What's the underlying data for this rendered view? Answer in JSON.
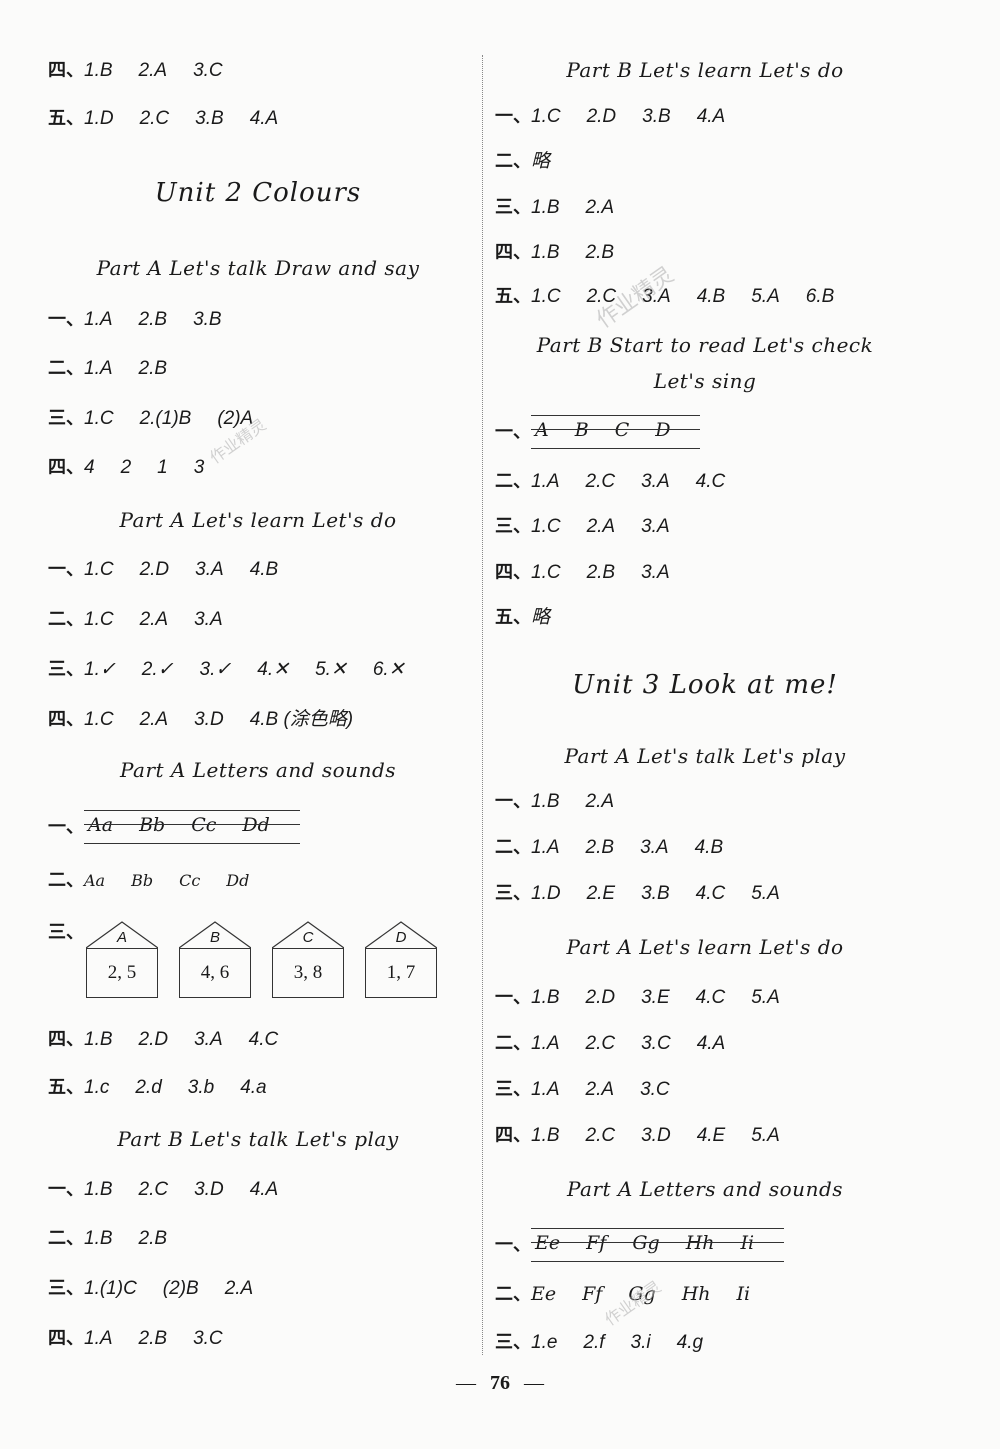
{
  "left": {
    "rows_top": [
      {
        "label": "四、",
        "items": [
          "1.B",
          "2.A",
          "3.C"
        ]
      },
      {
        "label": "五、",
        "items": [
          "1.D",
          "2.C",
          "3.B",
          "4.A"
        ]
      }
    ],
    "unit2_title": "Unit 2   Colours",
    "sections": [
      {
        "heading": "Part A   Let's talk   Draw and say",
        "rows": [
          {
            "label": "一、",
            "items": [
              "1.A",
              "2.B",
              "3.B"
            ]
          },
          {
            "label": "二、",
            "items": [
              "1.A",
              "2.B"
            ]
          },
          {
            "label": "三、",
            "items": [
              "1.C",
              "2.(1)B",
              "(2)A"
            ]
          },
          {
            "label": "四、",
            "items": [
              "4",
              "2",
              "1",
              "3"
            ]
          }
        ]
      },
      {
        "heading": "Part A   Let's learn   Let's do",
        "rows": [
          {
            "label": "一、",
            "items": [
              "1.C",
              "2.D",
              "3.A",
              "4.B"
            ]
          },
          {
            "label": "二、",
            "items": [
              "1.C",
              "2.A",
              "3.A"
            ]
          },
          {
            "label": "三、",
            "items": [
              "1.✓",
              "2.✓",
              "3.✓",
              "4.✕",
              "5.✕",
              "6.✕"
            ]
          },
          {
            "label": "四、",
            "items": [
              "1.C",
              "2.A",
              "3.D",
              "4.B (涂色略)"
            ]
          }
        ]
      },
      {
        "heading": "Part A   Letters and sounds",
        "lined": {
          "label": "一、",
          "letters": [
            "Aa",
            "Bb",
            "Cc",
            "Dd"
          ]
        },
        "row2": {
          "label": "二、",
          "items": [
            "Aa",
            "Bb",
            "Cc",
            "Dd"
          ]
        },
        "houses_label": "三、",
        "houses": [
          {
            "roof": "A",
            "value": "2, 5"
          },
          {
            "roof": "B",
            "value": "4, 6"
          },
          {
            "roof": "C",
            "value": "3, 8"
          },
          {
            "roof": "D",
            "value": "1, 7"
          }
        ],
        "rows": [
          {
            "label": "四、",
            "items": [
              "1.B",
              "2.D",
              "3.A",
              "4.C"
            ]
          },
          {
            "label": "五、",
            "items": [
              "1.c",
              "2.d",
              "3.b",
              "4.a"
            ]
          }
        ]
      },
      {
        "heading": "Part B   Let's talk   Let's play",
        "rows": [
          {
            "label": "一、",
            "items": [
              "1.B",
              "2.C",
              "3.D",
              "4.A"
            ]
          },
          {
            "label": "二、",
            "items": [
              "1.B",
              "2.B"
            ]
          },
          {
            "label": "三、",
            "items": [
              "1.(1)C",
              "(2)B",
              "2.A"
            ]
          },
          {
            "label": "四、",
            "items": [
              "1.A",
              "2.B",
              "3.C"
            ]
          }
        ]
      }
    ]
  },
  "right": {
    "sections": [
      {
        "heading": "Part B   Let's learn   Let's do",
        "rows": [
          {
            "label": "一、",
            "items": [
              "1.C",
              "2.D",
              "3.B",
              "4.A"
            ]
          },
          {
            "label": "二、",
            "items": [
              "略"
            ]
          },
          {
            "label": "三、",
            "items": [
              "1.B",
              "2.A"
            ]
          },
          {
            "label": "四、",
            "items": [
              "1.B",
              "2.B"
            ]
          },
          {
            "label": "五、",
            "items": [
              "1.C",
              "2.C",
              "3.A",
              "4.B",
              "5.A",
              "6.B"
            ]
          }
        ]
      },
      {
        "heading": "Part B   Start to read   Let's check",
        "heading2": "Let's sing",
        "lined": {
          "label": "一、",
          "letters": [
            "A",
            "B",
            "C",
            "D"
          ]
        },
        "rows": [
          {
            "label": "二、",
            "items": [
              "1.A",
              "2.C",
              "3.A",
              "4.C"
            ]
          },
          {
            "label": "三、",
            "items": [
              "1.C",
              "2.A",
              "3.A"
            ]
          },
          {
            "label": "四、",
            "items": [
              "1.C",
              "2.B",
              "3.A"
            ]
          },
          {
            "label": "五、",
            "items": [
              "略"
            ]
          }
        ]
      }
    ],
    "unit3_title": "Unit 3   Look at me!",
    "sections2": [
      {
        "heading": "Part A   Let's talk   Let's play",
        "rows": [
          {
            "label": "一、",
            "items": [
              "1.B",
              "2.A"
            ]
          },
          {
            "label": "二、",
            "items": [
              "1.A",
              "2.B",
              "3.A",
              "4.B"
            ]
          },
          {
            "label": "三、",
            "items": [
              "1.D",
              "2.E",
              "3.B",
              "4.C",
              "5.A"
            ]
          }
        ]
      },
      {
        "heading": "Part A   Let's learn   Let's do",
        "rows": [
          {
            "label": "一、",
            "items": [
              "1.B",
              "2.D",
              "3.E",
              "4.C",
              "5.A"
            ]
          },
          {
            "label": "二、",
            "items": [
              "1.A",
              "2.C",
              "3.C",
              "4.A"
            ]
          },
          {
            "label": "三、",
            "items": [
              "1.A",
              "2.A",
              "3.C"
            ]
          },
          {
            "label": "四、",
            "items": [
              "1.B",
              "2.C",
              "3.D",
              "4.E",
              "5.A"
            ]
          }
        ]
      },
      {
        "heading": "Part A   Letters and sounds",
        "lined": {
          "label": "一、",
          "letters": [
            "Ee",
            "Ff",
            "Gg",
            "Hh",
            "Ii"
          ]
        },
        "rows": [
          {
            "label": "二、",
            "items": [
              "Ee",
              "Ff",
              "Gg",
              "Hh",
              "Ii"
            ]
          },
          {
            "label": "三、",
            "items": [
              "1.e",
              "2.f",
              "3.i",
              "4.g"
            ]
          }
        ]
      }
    ]
  },
  "watermark_text": "作业精灵",
  "page_number": "76",
  "page_dash": "—"
}
